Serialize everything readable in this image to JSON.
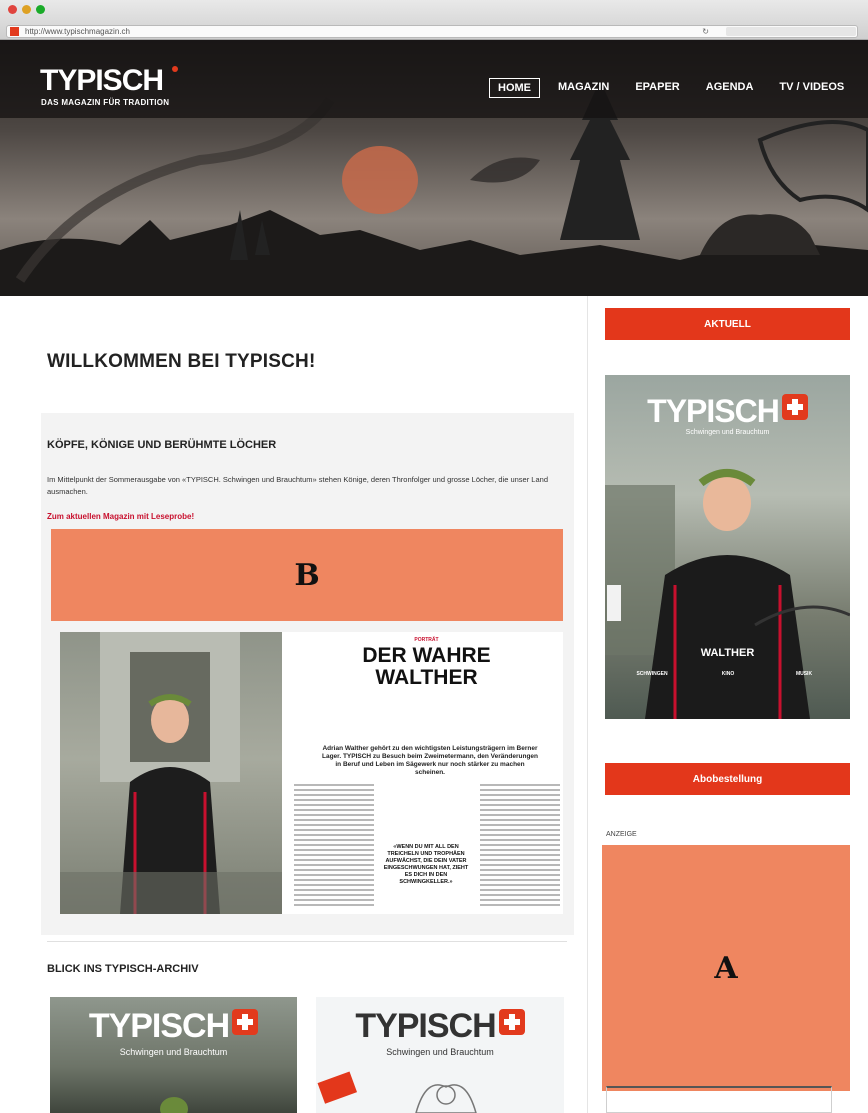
{
  "browser": {
    "url": "http://www.typischmagazin.ch"
  },
  "site": {
    "logo": "TYPISCH",
    "tagline": "DAS MAGAZIN FÜR TRADITION"
  },
  "nav": {
    "items": [
      {
        "label": "HOME",
        "active": true
      },
      {
        "label": "MAGAZIN",
        "active": false
      },
      {
        "label": "EPAPER",
        "active": false
      },
      {
        "label": "AGENDA",
        "active": false
      },
      {
        "label": "TV / VIDEOS",
        "active": false
      }
    ]
  },
  "main": {
    "welcome": "WILLKOMMEN BEI TYPISCH!",
    "feature": {
      "title": "KÖPFE, KÖNIGE UND BERÜHMTE LÖCHER",
      "text": "Im Mittelpunkt der Sommerausgabe von «TYPISCH. Schwingen und Brauchtum» stehen Könige, deren Thronfolger und grosse Löcher, die unser Land ausmachen.",
      "link": "Zum aktuellen Magazin mit Leseprobe!"
    },
    "redaction_b": "B",
    "spread": {
      "kicker": "PORTRÄT",
      "headline_1": "DER WAHRE",
      "headline_2": "WALTHER",
      "lead": "Adrian Walther gehört zu den wichtigsten Leistungsträgern im Berner Lager. TYPISCH zu Besuch beim Zweimetermann, den Veränderungen in Beruf und Leben im Sägewerk nur noch stärker zu machen scheinen.",
      "quote": "«WENN DU MIT ALL DEN TREICHELN UND TROPHÄEN AUFWÄCHST, DIE DEIN VATER EINGESCHWUNGEN HAT, ZIEHT ES DICH IN DEN SCHWINGKELLER.»"
    },
    "archive_title": "BLICK INS TYPISCH-ARCHIV",
    "archive": [
      {
        "logo": "TYPISCH",
        "sub": "Schwingen und Brauchtum"
      },
      {
        "logo": "TYPISCH",
        "sub": "Schwingen und Brauchtum"
      }
    ]
  },
  "sidebar": {
    "aktuell": "AKTUELL",
    "cover": {
      "logo": "TYPISCH",
      "sub": "Schwingen und Brauchtum",
      "name": "WALTHER",
      "teasers": [
        "SCHWINGEN",
        "KINO",
        "MUSIK"
      ]
    },
    "abo": "Abobestellung",
    "ad_label": "ANZEIGE",
    "redaction_a": "A"
  },
  "colors": {
    "accent_red": "#e3371b",
    "link_red": "#c8102e",
    "redaction": "#ef8660"
  }
}
